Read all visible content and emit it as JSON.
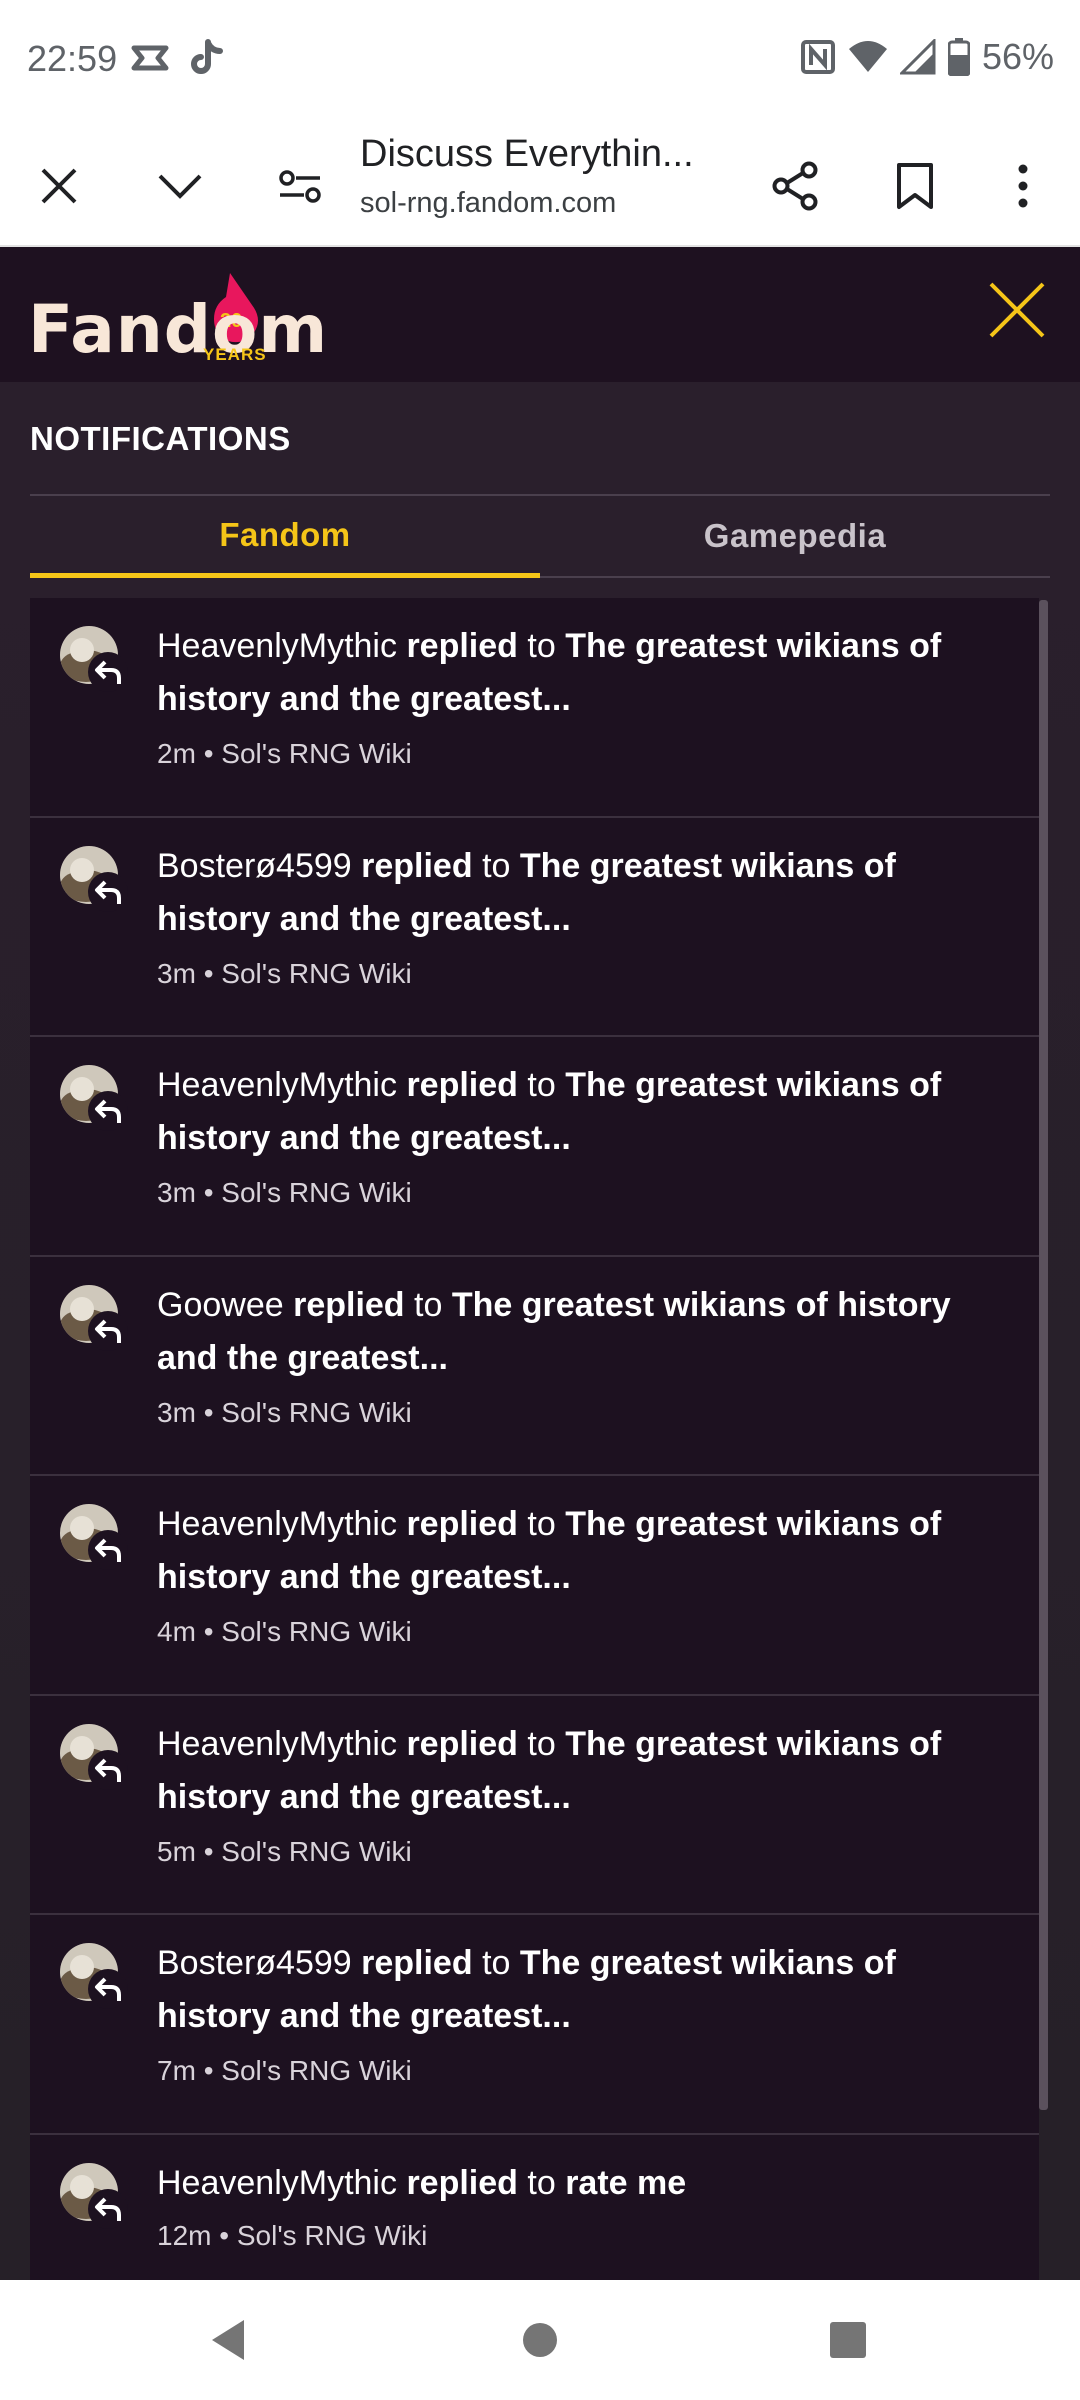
{
  "status_bar": {
    "time": "22:59",
    "battery": "56%",
    "icons": [
      "capcut-icon",
      "tiktok-icon",
      "nfc-icon",
      "wifi-icon",
      "signal-icon",
      "battery-icon"
    ]
  },
  "browser": {
    "page_title": "Discuss Everythin...",
    "domain": "sol-rng.fandom.com",
    "icons": [
      "close-icon",
      "chevron-down-icon",
      "site-settings-icon",
      "share-icon",
      "bookmark-icon",
      "more-icon"
    ]
  },
  "fandom": {
    "logo_text": "Fandom",
    "logo_badge": "20",
    "logo_years": "YEARS",
    "accent": "#f5c518"
  },
  "notifications": {
    "title": "NOTIFICATIONS",
    "tabs": [
      {
        "label": "Fandom",
        "active": true
      },
      {
        "label": "Gamepedia",
        "active": false
      }
    ],
    "items": [
      {
        "user": "HeavenlyMythic",
        "action": "replied",
        "to": "to",
        "thread": "The greatest wikians of history and the greatest...",
        "time": "2m",
        "wiki": "Sol's RNG Wiki"
      },
      {
        "user": "Bosterø4599",
        "action": "replied",
        "to": "to",
        "thread": "The greatest wikians of history and the greatest...",
        "time": "3m",
        "wiki": "Sol's RNG Wiki"
      },
      {
        "user": "HeavenlyMythic",
        "action": "replied",
        "to": "to",
        "thread": "The greatest wikians of history and the greatest...",
        "time": "3m",
        "wiki": "Sol's RNG Wiki"
      },
      {
        "user": "Goowee",
        "action": "replied",
        "to": "to",
        "thread": "The greatest wikians of history and the greatest...",
        "time": "3m",
        "wiki": "Sol's RNG Wiki"
      },
      {
        "user": "HeavenlyMythic",
        "action": "replied",
        "to": "to",
        "thread": "The greatest wikians of history and the greatest...",
        "time": "4m",
        "wiki": "Sol's RNG Wiki"
      },
      {
        "user": "HeavenlyMythic",
        "action": "replied",
        "to": "to",
        "thread": "The greatest wikians of history and the greatest...",
        "time": "5m",
        "wiki": "Sol's RNG Wiki"
      },
      {
        "user": "Bosterø4599",
        "action": "replied",
        "to": "to",
        "thread": "The greatest wikians of history and the greatest...",
        "time": "7m",
        "wiki": "Sol's RNG Wiki"
      },
      {
        "user": "HeavenlyMythic",
        "action": "replied",
        "to": "to",
        "thread": "rate me",
        "time": "12m",
        "wiki": "Sol's RNG Wiki"
      }
    ],
    "meta_separator": "•"
  },
  "nav_bar": {
    "icons": [
      "back-icon",
      "home-icon",
      "recents-icon"
    ]
  }
}
